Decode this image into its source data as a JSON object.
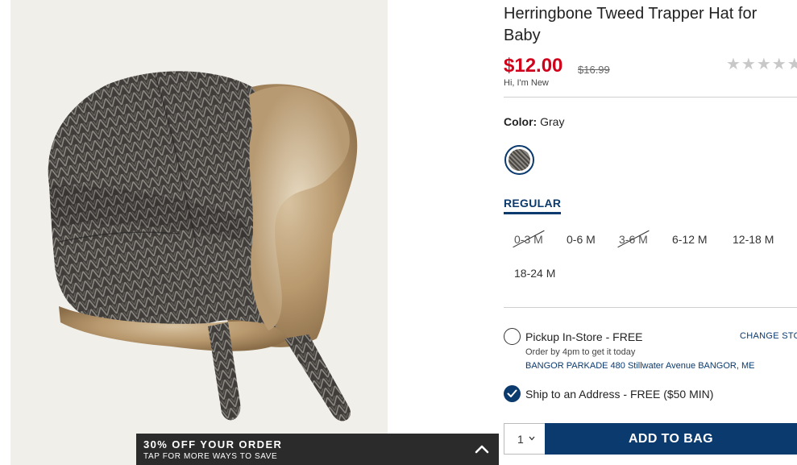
{
  "product": {
    "title": "Herringbone Tweed Trapper Hat for Baby",
    "price": "$12.00",
    "original_price": "$16.99",
    "badge": "Hi, I'm New",
    "rating_stars": "★★★★★"
  },
  "color": {
    "label": "Color:",
    "value": "Gray"
  },
  "size_group": {
    "label": "REGULAR",
    "sizes": [
      {
        "label": "0-3 M",
        "available": false
      },
      {
        "label": "0-6 M",
        "available": true
      },
      {
        "label": "3-6 M",
        "available": false
      },
      {
        "label": "6-12 M",
        "available": true
      },
      {
        "label": "12-18 M",
        "available": true
      },
      {
        "label": "18-24 M",
        "available": true
      }
    ]
  },
  "fulfillment": {
    "pickup_label": "Pickup In-Store - FREE",
    "change_store": "CHANGE STORE",
    "pickup_note": "Order by 4pm to get it today",
    "store_address": "BANGOR PARKADE 480 Stillwater Avenue  BANGOR, ME",
    "ship_label": "Ship to an Address - FREE ($50 MIN)",
    "selected": "ship"
  },
  "cart": {
    "quantity": "1",
    "add_label": "ADD TO BAG"
  },
  "promo": {
    "title": "30% OFF YOUR ORDER",
    "subtitle": "TAP FOR MORE WAYS TO SAVE"
  },
  "colors": {
    "accent_navy": "#0b3a6e",
    "sale_red": "#d0021b",
    "promo_bg": "#2b2b2b"
  }
}
